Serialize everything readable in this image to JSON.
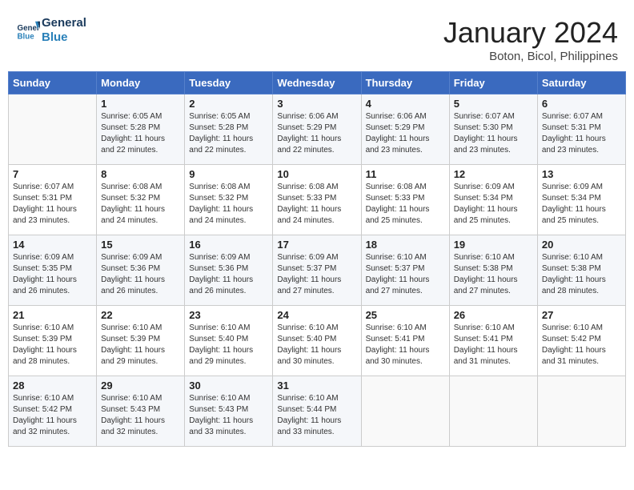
{
  "header": {
    "logo_line1": "General",
    "logo_line2": "Blue",
    "title": "January 2024",
    "subtitle": "Boton, Bicol, Philippines"
  },
  "days_of_week": [
    "Sunday",
    "Monday",
    "Tuesday",
    "Wednesday",
    "Thursday",
    "Friday",
    "Saturday"
  ],
  "weeks": [
    [
      {
        "day": "",
        "info": ""
      },
      {
        "day": "1",
        "info": "Sunrise: 6:05 AM\nSunset: 5:28 PM\nDaylight: 11 hours\nand 22 minutes."
      },
      {
        "day": "2",
        "info": "Sunrise: 6:05 AM\nSunset: 5:28 PM\nDaylight: 11 hours\nand 22 minutes."
      },
      {
        "day": "3",
        "info": "Sunrise: 6:06 AM\nSunset: 5:29 PM\nDaylight: 11 hours\nand 22 minutes."
      },
      {
        "day": "4",
        "info": "Sunrise: 6:06 AM\nSunset: 5:29 PM\nDaylight: 11 hours\nand 23 minutes."
      },
      {
        "day": "5",
        "info": "Sunrise: 6:07 AM\nSunset: 5:30 PM\nDaylight: 11 hours\nand 23 minutes."
      },
      {
        "day": "6",
        "info": "Sunrise: 6:07 AM\nSunset: 5:31 PM\nDaylight: 11 hours\nand 23 minutes."
      }
    ],
    [
      {
        "day": "7",
        "info": "Sunrise: 6:07 AM\nSunset: 5:31 PM\nDaylight: 11 hours\nand 23 minutes."
      },
      {
        "day": "8",
        "info": "Sunrise: 6:08 AM\nSunset: 5:32 PM\nDaylight: 11 hours\nand 24 minutes."
      },
      {
        "day": "9",
        "info": "Sunrise: 6:08 AM\nSunset: 5:32 PM\nDaylight: 11 hours\nand 24 minutes."
      },
      {
        "day": "10",
        "info": "Sunrise: 6:08 AM\nSunset: 5:33 PM\nDaylight: 11 hours\nand 24 minutes."
      },
      {
        "day": "11",
        "info": "Sunrise: 6:08 AM\nSunset: 5:33 PM\nDaylight: 11 hours\nand 25 minutes."
      },
      {
        "day": "12",
        "info": "Sunrise: 6:09 AM\nSunset: 5:34 PM\nDaylight: 11 hours\nand 25 minutes."
      },
      {
        "day": "13",
        "info": "Sunrise: 6:09 AM\nSunset: 5:34 PM\nDaylight: 11 hours\nand 25 minutes."
      }
    ],
    [
      {
        "day": "14",
        "info": "Sunrise: 6:09 AM\nSunset: 5:35 PM\nDaylight: 11 hours\nand 26 minutes."
      },
      {
        "day": "15",
        "info": "Sunrise: 6:09 AM\nSunset: 5:36 PM\nDaylight: 11 hours\nand 26 minutes."
      },
      {
        "day": "16",
        "info": "Sunrise: 6:09 AM\nSunset: 5:36 PM\nDaylight: 11 hours\nand 26 minutes."
      },
      {
        "day": "17",
        "info": "Sunrise: 6:09 AM\nSunset: 5:37 PM\nDaylight: 11 hours\nand 27 minutes."
      },
      {
        "day": "18",
        "info": "Sunrise: 6:10 AM\nSunset: 5:37 PM\nDaylight: 11 hours\nand 27 minutes."
      },
      {
        "day": "19",
        "info": "Sunrise: 6:10 AM\nSunset: 5:38 PM\nDaylight: 11 hours\nand 27 minutes."
      },
      {
        "day": "20",
        "info": "Sunrise: 6:10 AM\nSunset: 5:38 PM\nDaylight: 11 hours\nand 28 minutes."
      }
    ],
    [
      {
        "day": "21",
        "info": "Sunrise: 6:10 AM\nSunset: 5:39 PM\nDaylight: 11 hours\nand 28 minutes."
      },
      {
        "day": "22",
        "info": "Sunrise: 6:10 AM\nSunset: 5:39 PM\nDaylight: 11 hours\nand 29 minutes."
      },
      {
        "day": "23",
        "info": "Sunrise: 6:10 AM\nSunset: 5:40 PM\nDaylight: 11 hours\nand 29 minutes."
      },
      {
        "day": "24",
        "info": "Sunrise: 6:10 AM\nSunset: 5:40 PM\nDaylight: 11 hours\nand 30 minutes."
      },
      {
        "day": "25",
        "info": "Sunrise: 6:10 AM\nSunset: 5:41 PM\nDaylight: 11 hours\nand 30 minutes."
      },
      {
        "day": "26",
        "info": "Sunrise: 6:10 AM\nSunset: 5:41 PM\nDaylight: 11 hours\nand 31 minutes."
      },
      {
        "day": "27",
        "info": "Sunrise: 6:10 AM\nSunset: 5:42 PM\nDaylight: 11 hours\nand 31 minutes."
      }
    ],
    [
      {
        "day": "28",
        "info": "Sunrise: 6:10 AM\nSunset: 5:42 PM\nDaylight: 11 hours\nand 32 minutes."
      },
      {
        "day": "29",
        "info": "Sunrise: 6:10 AM\nSunset: 5:43 PM\nDaylight: 11 hours\nand 32 minutes."
      },
      {
        "day": "30",
        "info": "Sunrise: 6:10 AM\nSunset: 5:43 PM\nDaylight: 11 hours\nand 33 minutes."
      },
      {
        "day": "31",
        "info": "Sunrise: 6:10 AM\nSunset: 5:44 PM\nDaylight: 11 hours\nand 33 minutes."
      },
      {
        "day": "",
        "info": ""
      },
      {
        "day": "",
        "info": ""
      },
      {
        "day": "",
        "info": ""
      }
    ]
  ]
}
